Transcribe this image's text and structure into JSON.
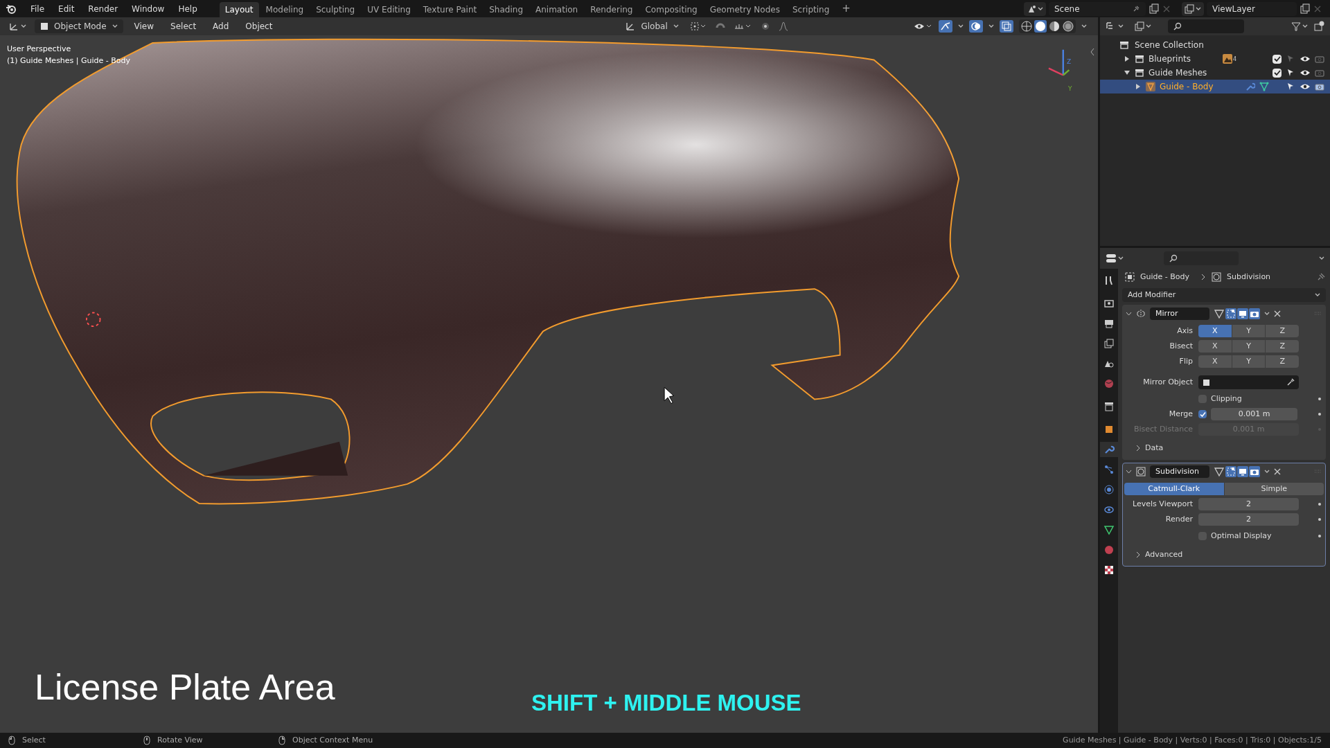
{
  "menu": [
    "File",
    "Edit",
    "Render",
    "Window",
    "Help"
  ],
  "workspaces": [
    {
      "label": "Layout",
      "selected": true
    },
    {
      "label": "Modeling",
      "selected": false
    },
    {
      "label": "Sculpting",
      "selected": false
    },
    {
      "label": "UV Editing",
      "selected": false
    },
    {
      "label": "Texture Paint",
      "selected": false
    },
    {
      "label": "Shading",
      "selected": false
    },
    {
      "label": "Animation",
      "selected": false
    },
    {
      "label": "Rendering",
      "selected": false
    },
    {
      "label": "Compositing",
      "selected": false
    },
    {
      "label": "Geometry Nodes",
      "selected": false
    },
    {
      "label": "Scripting",
      "selected": false
    }
  ],
  "add_workspace": "+",
  "scene": "Scene",
  "view_layer": "ViewLayer",
  "viewport_header": {
    "mode": "Object Mode",
    "menus": [
      "View",
      "Select",
      "Add",
      "Object"
    ],
    "orientation": "Global"
  },
  "viewport": {
    "perspective": "User Perspective",
    "object_info": "(1) Guide Meshes | Guide - Body",
    "gizmo_z": "Z",
    "gizmo_y": "Y",
    "caption": "License Plate Area",
    "hint": "SHIFT + MIDDLE MOUSE"
  },
  "outliner": {
    "root": "Scene Collection",
    "items": [
      {
        "kind": "collection",
        "label": "Blueprints",
        "expanded": false,
        "selected": false,
        "checked": true,
        "badge": "4"
      },
      {
        "kind": "collection",
        "label": "Guide Meshes",
        "expanded": true,
        "selected": false,
        "checked": true,
        "children": [
          {
            "kind": "object",
            "label": "Guide - Body",
            "expanded": false,
            "selected": true
          }
        ]
      }
    ]
  },
  "properties": {
    "breadcrumb": [
      "Guide - Body",
      "Subdivision"
    ],
    "add_modifier": "Add Modifier",
    "modifiers": [
      {
        "kind": "mirror",
        "name": "Mirror",
        "active": false,
        "expanded": true,
        "toggle_rows": [
          {
            "label": "Axis",
            "buttons": [
              {
                "label": "X",
                "on": true
              },
              {
                "label": "Y",
                "on": false
              },
              {
                "label": "Z",
                "on": false
              }
            ]
          },
          {
            "label": "Bisect",
            "buttons": [
              {
                "label": "X",
                "on": false
              },
              {
                "label": "Y",
                "on": false
              },
              {
                "label": "Z",
                "on": false
              }
            ]
          },
          {
            "label": "Flip",
            "buttons": [
              {
                "label": "X",
                "on": false
              },
              {
                "label": "Y",
                "on": false
              },
              {
                "label": "Z",
                "on": false
              }
            ]
          }
        ],
        "mirror_object": "Mirror Object",
        "clipping": {
          "label": "Clipping",
          "checked": false
        },
        "merge": {
          "label": "Merge",
          "checked": true,
          "value": "0.001 m"
        },
        "bisect_distance": {
          "label": "Bisect Distance",
          "value": "0.001 m",
          "disabled": true
        },
        "subpanel": "Data"
      },
      {
        "kind": "subdivision",
        "name": "Subdivision",
        "active": true,
        "expanded": true,
        "methods": [
          {
            "label": "Catmull-Clark",
            "selected": true
          },
          {
            "label": "Simple",
            "selected": false
          }
        ],
        "fields": [
          {
            "label": "Levels Viewport",
            "value": "2"
          },
          {
            "label": "Render",
            "value": "2"
          }
        ],
        "optimal_display": {
          "label": "Optimal Display",
          "checked": false
        },
        "subpanel": "Advanced"
      }
    ]
  },
  "status_bar": {
    "hints": [
      "Select",
      "Rotate View",
      "Object Context Menu"
    ],
    "stats": "Guide Meshes | Guide - Body | Verts:0 | Faces:0 | Tris:0 | Objects:1/5"
  }
}
